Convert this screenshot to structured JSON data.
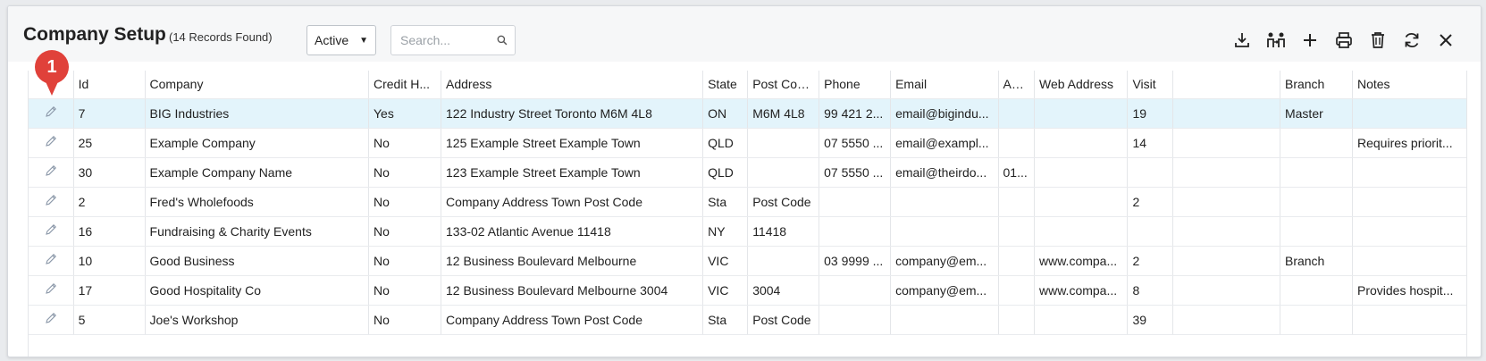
{
  "header": {
    "title": "Company Setup",
    "records": "(14 Records Found)",
    "status_value": "Active",
    "search_placeholder": "Search..."
  },
  "callout": {
    "number": "1",
    "color": "#e0413a"
  },
  "toolbar": [
    "download-icon",
    "assign-users-icon",
    "add-icon",
    "print-icon",
    "delete-icon",
    "refresh-icon",
    "close-icon"
  ],
  "columns": [
    "Id",
    "Company",
    "Credit H...",
    "Address",
    "State",
    "Post Cod...",
    "Phone",
    "Email",
    "AB...",
    "Web Address",
    "Visit",
    "",
    "Branch",
    "Notes"
  ],
  "rows": [
    [
      "7",
      "BIG Industries",
      "Yes",
      "122 Industry Street Toronto M6M 4L8",
      "ON",
      "M6M 4L8",
      "99 421 2...",
      "email@bigindu...",
      "",
      "",
      "19",
      "",
      "Master",
      ""
    ],
    [
      "25",
      "Example Company",
      "No",
      "125 Example Street Example Town",
      "QLD",
      "",
      "07 5550 ...",
      "email@exampl...",
      "",
      "",
      "14",
      "",
      "",
      "Requires priorit..."
    ],
    [
      "30",
      "Example Company Name",
      "No",
      "123 Example Street Example Town",
      "QLD",
      "",
      "07 5550 ...",
      "email@theirdo...",
      "01...",
      "",
      "",
      "",
      "",
      ""
    ],
    [
      "2",
      "Fred's Wholefoods",
      "No",
      "Company Address Town Post Code",
      "Sta",
      "Post Code",
      "",
      "",
      "",
      "",
      "2",
      "",
      "",
      ""
    ],
    [
      "16",
      "Fundraising & Charity Events",
      "No",
      "133-02 Atlantic Avenue 11418",
      "NY",
      "11418",
      "",
      "",
      "",
      "",
      "",
      "",
      "",
      ""
    ],
    [
      "10",
      "Good Business",
      "No",
      "12 Business Boulevard Melbourne",
      "VIC",
      "",
      "03 9999 ...",
      "company@em...",
      "",
      "www.compa...",
      "2",
      "",
      "Branch",
      ""
    ],
    [
      "17",
      "Good Hospitality Co",
      "No",
      "12 Business Boulevard Melbourne 3004",
      "VIC",
      "3004",
      "",
      "company@em...",
      "",
      "www.compa...",
      "8",
      "",
      "",
      "Provides hospit..."
    ],
    [
      "5",
      "Joe's Workshop",
      "No",
      "Company Address Town Post Code",
      "Sta",
      "Post Code",
      "",
      "",
      "",
      "",
      "39",
      "",
      "",
      ""
    ]
  ],
  "selected_row": 0,
  "colors": {
    "accent": "#e0413a",
    "selected_row": "#e3f4fb",
    "edit_icon": "#8a97a8"
  }
}
